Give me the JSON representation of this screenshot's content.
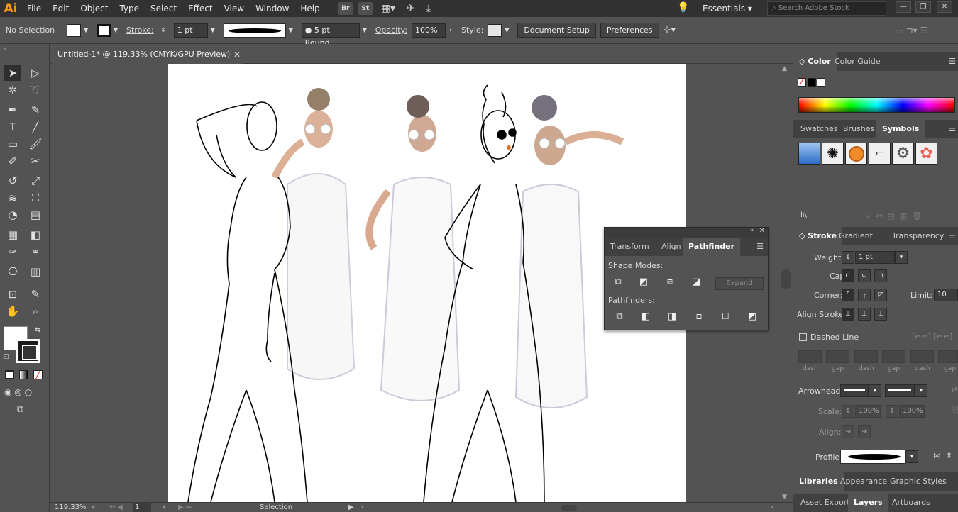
{
  "app": {
    "logo": "Ai",
    "menu": [
      "File",
      "Edit",
      "Object",
      "Type",
      "Select",
      "Effect",
      "View",
      "Window",
      "Help"
    ],
    "bridge_icon": "Br",
    "stock_icon": "St",
    "workspace": "Essentials",
    "search_placeholder": "Search Adobe Stock"
  },
  "control": {
    "selection_status": "No Selection",
    "stroke_label": "Stroke:",
    "stroke_weight": "1 pt",
    "brush": "5 pt. Round",
    "opacity_label": "Opacity:",
    "opacity_value": "100%",
    "style_label": "Style:",
    "document_setup": "Document Setup",
    "preferences": "Preferences"
  },
  "document": {
    "tab_title": "Untitled-1* @ 119.33% (CMYK/GPU Preview)",
    "zoom": "119.33%",
    "artboard_number": "1",
    "status_tool": "Selection"
  },
  "panels": {
    "color_tabs": [
      "Color",
      "Color Guide"
    ],
    "library_tabs": [
      "Swatches",
      "Brushes",
      "Symbols"
    ],
    "stroke_tabs": [
      "Stroke",
      "Gradient",
      "Transparency"
    ],
    "stroke": {
      "weight_label": "Weight:",
      "weight_value": "1 pt",
      "cap_label": "Cap:",
      "corner_label": "Corner:",
      "limit_label": "Limit:",
      "limit_value": "10",
      "align_label": "Align Stroke:",
      "dashed_line": "Dashed Line",
      "dash_labels": [
        "dash",
        "gap",
        "dash",
        "gap",
        "dash",
        "gap"
      ],
      "arrowheads_label": "Arrowheads:",
      "scale_label": "Scale:",
      "scale_value_1": "100%",
      "scale_value_2": "100%",
      "align_arrow_label": "Align:",
      "profile_label": "Profile:"
    },
    "bottom_tabs_1": [
      "Libraries",
      "Appearance",
      "Graphic Styles"
    ],
    "bottom_tabs_2": [
      "Asset Export",
      "Layers",
      "Artboards"
    ]
  },
  "pathfinder": {
    "tabs": [
      "Transform",
      "Align",
      "Pathfinder"
    ],
    "shape_modes_label": "Shape Modes:",
    "expand": "Expand",
    "pathfinders_label": "Pathfinders:"
  }
}
